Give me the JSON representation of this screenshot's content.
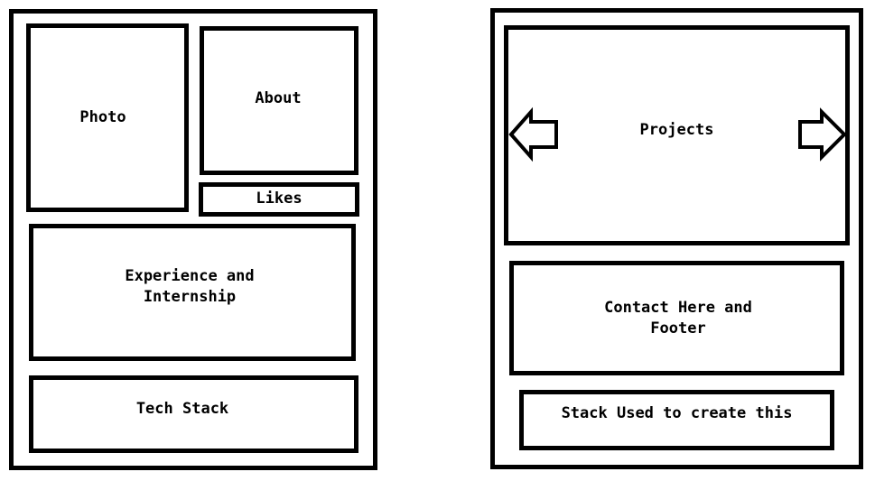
{
  "left_page": {
    "photo": "Photo",
    "about": "About",
    "likes": "Likes",
    "experience": "Experience and\nInternship",
    "tech_stack": "Tech Stack"
  },
  "right_page": {
    "projects": "Projects",
    "contact": "Contact Here and\nFooter",
    "stack_used": "Stack Used to create this"
  },
  "icons": {
    "prev": "left-arrow-icon",
    "next": "right-arrow-icon"
  },
  "colors": {
    "stroke": "#000000",
    "background": "#ffffff"
  }
}
